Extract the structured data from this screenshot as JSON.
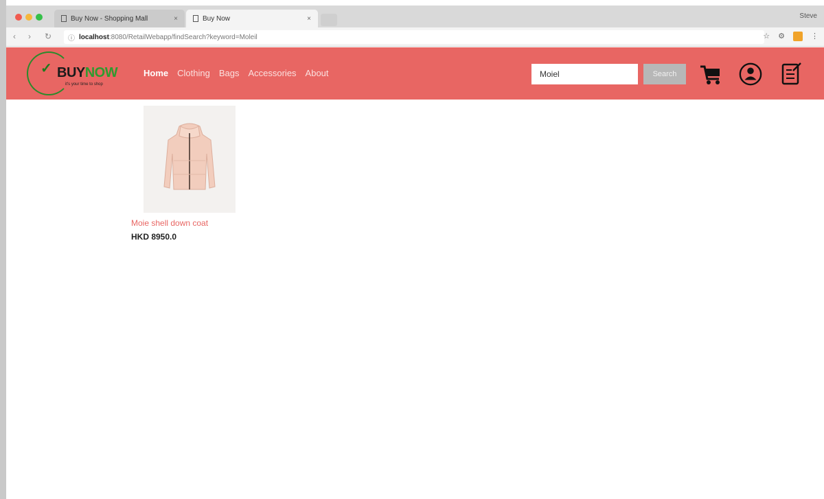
{
  "browser": {
    "tabs": [
      {
        "label": "Buy Now - Shopping Mall"
      },
      {
        "label": "Buy Now"
      }
    ],
    "profile_label": "Steve",
    "url_host": "localhost",
    "url_path": ":8080/RetailWebapp/findSearch?keyword=Moleil"
  },
  "site": {
    "logo_buy": "BUY",
    "logo_now": "NOW",
    "logo_tagline": "it's your time to shop",
    "nav": [
      {
        "label": "Home"
      },
      {
        "label": "Clothing"
      },
      {
        "label": "Bags"
      },
      {
        "label": "Accessories"
      },
      {
        "label": "About"
      }
    ],
    "search": {
      "value": "Moiel",
      "button_label": "Search"
    }
  },
  "results": [
    {
      "name": "Moie shell down coat",
      "price": "HKD 8950.0"
    }
  ],
  "colors": {
    "header_bg": "#e86663",
    "product_name": "#e86663",
    "search_button": "#b7b7b7",
    "logo_green": "#2f9a2f"
  }
}
